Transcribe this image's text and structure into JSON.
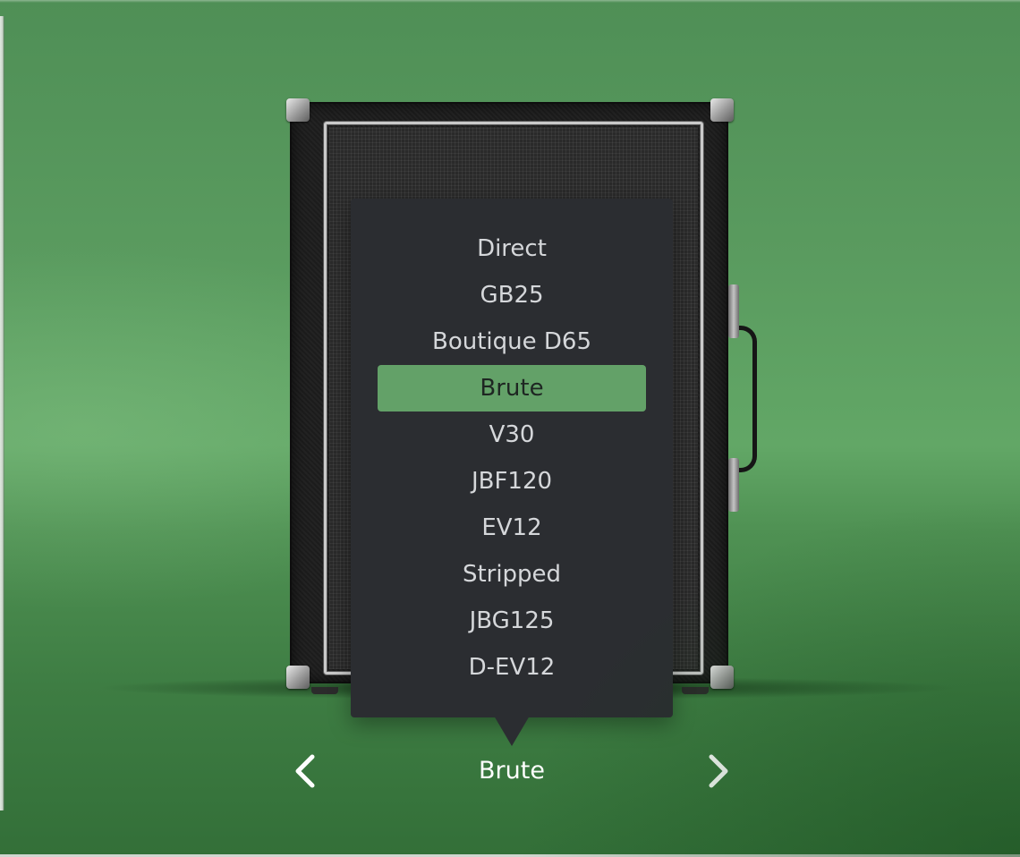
{
  "cabinet_menu": {
    "options": [
      {
        "label": "Direct",
        "selected": false
      },
      {
        "label": "GB25",
        "selected": false
      },
      {
        "label": "Boutique D65",
        "selected": false
      },
      {
        "label": "Brute",
        "selected": true
      },
      {
        "label": "V30",
        "selected": false
      },
      {
        "label": "JBF120",
        "selected": false
      },
      {
        "label": "EV12",
        "selected": false
      },
      {
        "label": "Stripped",
        "selected": false
      },
      {
        "label": "JBG125",
        "selected": false
      },
      {
        "label": "D-EV12",
        "selected": false
      }
    ]
  },
  "selector": {
    "current_label": "Brute",
    "prev_icon": "chevron-left-icon",
    "next_icon": "chevron-right-icon"
  },
  "colors": {
    "background": "#5a9b5f",
    "menu_background": "#2b2d31",
    "menu_text": "#d5d7da",
    "selected_highlight": "#63a168",
    "label_text": "#ffffff"
  }
}
